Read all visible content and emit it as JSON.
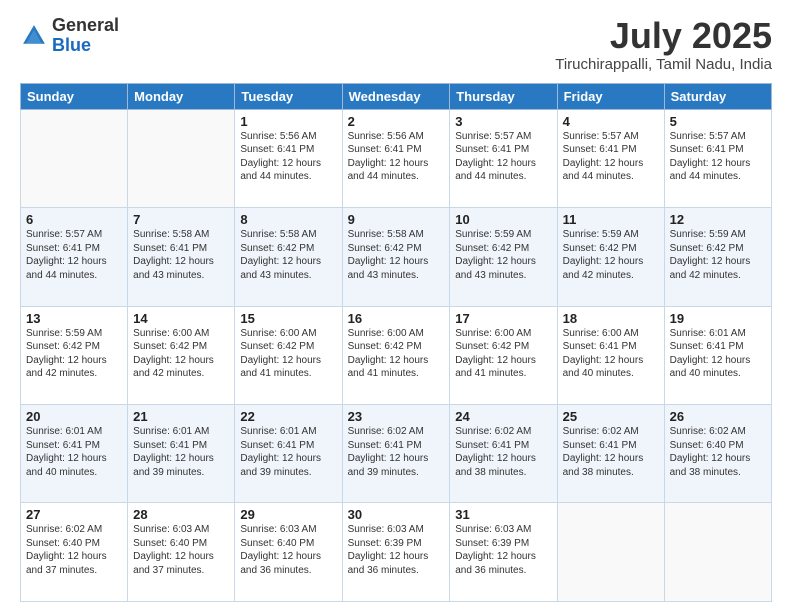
{
  "header": {
    "logo_general": "General",
    "logo_blue": "Blue",
    "title": "July 2025",
    "subtitle": "Tiruchirappalli, Tamil Nadu, India"
  },
  "calendar": {
    "weekdays": [
      "Sunday",
      "Monday",
      "Tuesday",
      "Wednesday",
      "Thursday",
      "Friday",
      "Saturday"
    ],
    "weeks": [
      [
        {
          "day": "",
          "info": ""
        },
        {
          "day": "",
          "info": ""
        },
        {
          "day": "1",
          "info": "Sunrise: 5:56 AM\nSunset: 6:41 PM\nDaylight: 12 hours and 44 minutes."
        },
        {
          "day": "2",
          "info": "Sunrise: 5:56 AM\nSunset: 6:41 PM\nDaylight: 12 hours and 44 minutes."
        },
        {
          "day": "3",
          "info": "Sunrise: 5:57 AM\nSunset: 6:41 PM\nDaylight: 12 hours and 44 minutes."
        },
        {
          "day": "4",
          "info": "Sunrise: 5:57 AM\nSunset: 6:41 PM\nDaylight: 12 hours and 44 minutes."
        },
        {
          "day": "5",
          "info": "Sunrise: 5:57 AM\nSunset: 6:41 PM\nDaylight: 12 hours and 44 minutes."
        }
      ],
      [
        {
          "day": "6",
          "info": "Sunrise: 5:57 AM\nSunset: 6:41 PM\nDaylight: 12 hours and 44 minutes."
        },
        {
          "day": "7",
          "info": "Sunrise: 5:58 AM\nSunset: 6:41 PM\nDaylight: 12 hours and 43 minutes."
        },
        {
          "day": "8",
          "info": "Sunrise: 5:58 AM\nSunset: 6:42 PM\nDaylight: 12 hours and 43 minutes."
        },
        {
          "day": "9",
          "info": "Sunrise: 5:58 AM\nSunset: 6:42 PM\nDaylight: 12 hours and 43 minutes."
        },
        {
          "day": "10",
          "info": "Sunrise: 5:59 AM\nSunset: 6:42 PM\nDaylight: 12 hours and 43 minutes."
        },
        {
          "day": "11",
          "info": "Sunrise: 5:59 AM\nSunset: 6:42 PM\nDaylight: 12 hours and 42 minutes."
        },
        {
          "day": "12",
          "info": "Sunrise: 5:59 AM\nSunset: 6:42 PM\nDaylight: 12 hours and 42 minutes."
        }
      ],
      [
        {
          "day": "13",
          "info": "Sunrise: 5:59 AM\nSunset: 6:42 PM\nDaylight: 12 hours and 42 minutes."
        },
        {
          "day": "14",
          "info": "Sunrise: 6:00 AM\nSunset: 6:42 PM\nDaylight: 12 hours and 42 minutes."
        },
        {
          "day": "15",
          "info": "Sunrise: 6:00 AM\nSunset: 6:42 PM\nDaylight: 12 hours and 41 minutes."
        },
        {
          "day": "16",
          "info": "Sunrise: 6:00 AM\nSunset: 6:42 PM\nDaylight: 12 hours and 41 minutes."
        },
        {
          "day": "17",
          "info": "Sunrise: 6:00 AM\nSunset: 6:42 PM\nDaylight: 12 hours and 41 minutes."
        },
        {
          "day": "18",
          "info": "Sunrise: 6:00 AM\nSunset: 6:41 PM\nDaylight: 12 hours and 40 minutes."
        },
        {
          "day": "19",
          "info": "Sunrise: 6:01 AM\nSunset: 6:41 PM\nDaylight: 12 hours and 40 minutes."
        }
      ],
      [
        {
          "day": "20",
          "info": "Sunrise: 6:01 AM\nSunset: 6:41 PM\nDaylight: 12 hours and 40 minutes."
        },
        {
          "day": "21",
          "info": "Sunrise: 6:01 AM\nSunset: 6:41 PM\nDaylight: 12 hours and 39 minutes."
        },
        {
          "day": "22",
          "info": "Sunrise: 6:01 AM\nSunset: 6:41 PM\nDaylight: 12 hours and 39 minutes."
        },
        {
          "day": "23",
          "info": "Sunrise: 6:02 AM\nSunset: 6:41 PM\nDaylight: 12 hours and 39 minutes."
        },
        {
          "day": "24",
          "info": "Sunrise: 6:02 AM\nSunset: 6:41 PM\nDaylight: 12 hours and 38 minutes."
        },
        {
          "day": "25",
          "info": "Sunrise: 6:02 AM\nSunset: 6:41 PM\nDaylight: 12 hours and 38 minutes."
        },
        {
          "day": "26",
          "info": "Sunrise: 6:02 AM\nSunset: 6:40 PM\nDaylight: 12 hours and 38 minutes."
        }
      ],
      [
        {
          "day": "27",
          "info": "Sunrise: 6:02 AM\nSunset: 6:40 PM\nDaylight: 12 hours and 37 minutes."
        },
        {
          "day": "28",
          "info": "Sunrise: 6:03 AM\nSunset: 6:40 PM\nDaylight: 12 hours and 37 minutes."
        },
        {
          "day": "29",
          "info": "Sunrise: 6:03 AM\nSunset: 6:40 PM\nDaylight: 12 hours and 36 minutes."
        },
        {
          "day": "30",
          "info": "Sunrise: 6:03 AM\nSunset: 6:39 PM\nDaylight: 12 hours and 36 minutes."
        },
        {
          "day": "31",
          "info": "Sunrise: 6:03 AM\nSunset: 6:39 PM\nDaylight: 12 hours and 36 minutes."
        },
        {
          "day": "",
          "info": ""
        },
        {
          "day": "",
          "info": ""
        }
      ]
    ]
  }
}
